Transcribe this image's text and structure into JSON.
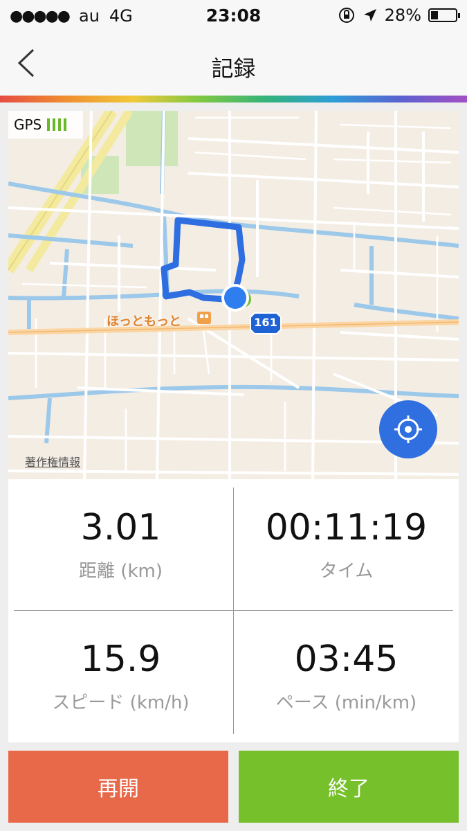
{
  "status_bar": {
    "signal": "●●●●●",
    "carrier": "au",
    "network": "4G",
    "time": "23:08",
    "battery_percent": "28%",
    "battery_level": 0.28
  },
  "nav": {
    "title": "記録",
    "back_icon": "chevron-left-icon"
  },
  "map": {
    "gps_label": "GPS",
    "gps_signal_bars": 4,
    "poi_label": "ほっともっと",
    "route_shield": "161",
    "copyright_link": "著作権情報",
    "route_color": "#2e6ee0",
    "locate_icon": "crosshair-icon"
  },
  "stats": [
    {
      "value": "3.01",
      "label": "距離 (km)"
    },
    {
      "value": "00:11:19",
      "label": "タイム"
    },
    {
      "value": "15.9",
      "label": "スピード (km/h)"
    },
    {
      "value": "03:45",
      "label": "ペース (min/km)"
    }
  ],
  "buttons": {
    "resume": "再開",
    "finish": "終了"
  },
  "colors": {
    "resume": "#e8694a",
    "finish": "#76c02b",
    "accent_blue": "#2f6fe0"
  }
}
